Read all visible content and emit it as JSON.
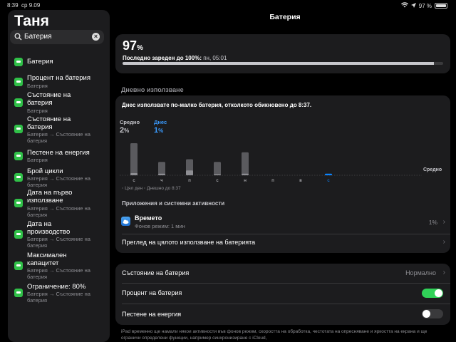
{
  "status_bar": {
    "time": "8:39",
    "date": "ср 9.09",
    "battery": "97 %",
    "battery_level": 0.97
  },
  "sidebar": {
    "title": "Таня",
    "search": {
      "value": "Батерия"
    },
    "results": [
      {
        "title": "Батерия",
        "subtitle": ""
      },
      {
        "title": "Процент на батерия",
        "subtitle": "Батерия"
      },
      {
        "title": "Състояние на батерия",
        "subtitle": "Батерия"
      },
      {
        "title": "Състояние на батерия",
        "subtitle": "Батерия → Състояние на батерия"
      },
      {
        "title": "Пестене на енергия",
        "subtitle": "Батерия"
      },
      {
        "title": "Брой цикли",
        "subtitle": "Батерия → Състояние на батерия"
      },
      {
        "title": "Дата на първо използване",
        "subtitle": "Батерия → Състояние на батерия"
      },
      {
        "title": "Дата на производство",
        "subtitle": "Батерия → Състояние на батерия"
      },
      {
        "title": "Максимален капацитет",
        "subtitle": "Батерия → Състояние на батерия"
      },
      {
        "title": "Ограничение: 80%",
        "subtitle": "Батерия → Състояние на батерия"
      }
    ]
  },
  "main": {
    "title": "Батерия",
    "battery": {
      "percent": "97",
      "percent_unit": "%",
      "level": 0.97,
      "last_charged_label": "Последно зареден до 100%:",
      "last_charged_time": "пн, 05:01"
    },
    "daily_header": "Дневно използване",
    "usage": {
      "message": "Днес използвате по-малко батерия, отколкото обикновено до 8:37.",
      "average_label": "Средно",
      "average_value": "2",
      "today_label": "Днес",
      "today_value": "1",
      "unit": "%",
      "legend": "◦ Цял ден  ◦ Днешно до 8:37"
    },
    "apps": {
      "header": "Приложения и системни активности",
      "items": [
        {
          "name": "Времето",
          "subtitle": "Фонов режим: 1 мин",
          "percent": "1%"
        }
      ],
      "view_all": "Преглед на цялото използване на батерията"
    },
    "settings": {
      "health_label": "Състояние на батерия",
      "health_value": "Нормално",
      "percentage_label": "Процент на батерия",
      "percentage_on": true,
      "low_power_label": "Пестене на енергия",
      "low_power_on": false
    },
    "footnote": "iPad временно ще намали някои активности във фонов режим, скоростта на обработка, честотата на опресняване и яркостта на екрана и ще ограничи определени функции, например синхронизиране с iCloud,"
  },
  "colors": {
    "accent_green": "#30d158",
    "today_blue": "#0a84ff",
    "bar_gray": "#5a5a5e"
  },
  "chart_data": {
    "type": "bar",
    "categories": [
      "с",
      "ч",
      "п",
      "с",
      "н",
      "п",
      "в",
      "с"
    ],
    "series": [
      {
        "values": [
          6.0,
          2.5,
          3.0,
          2.5,
          4.3,
          0,
          0,
          0.05
        ]
      },
      {
        "values": [
          0.4,
          0.3,
          0.9,
          0.2,
          0.3,
          0,
          0,
          0.3
        ]
      }
    ],
    "average_line_label": "Средно",
    "ylim": [
      0,
      6
    ],
    "highlight_category_index": 7
  }
}
